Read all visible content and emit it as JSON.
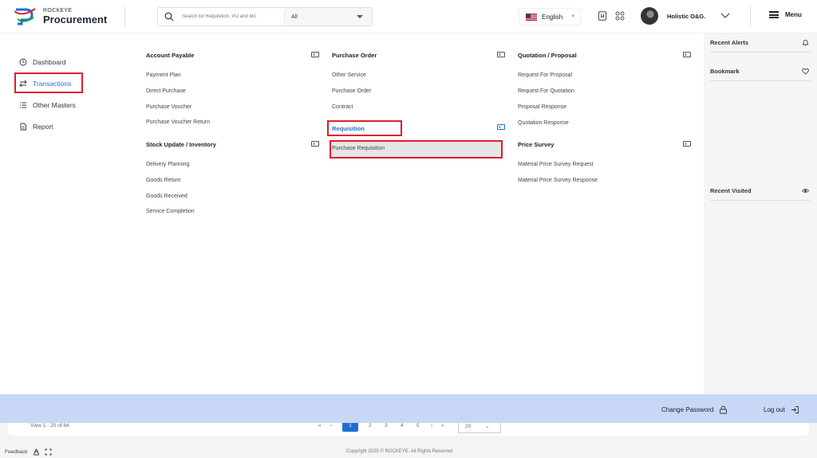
{
  "app": {
    "brand_top": "ROCKEYE",
    "brand_bottom": "Procurement"
  },
  "search": {
    "placeholder": "Search for Requisition, PO and Mo",
    "filter_value": "All"
  },
  "header": {
    "language": "English",
    "user_name": "Holistic O&G.",
    "menu_label": "Menu"
  },
  "sidebar": {
    "items": [
      {
        "label": "Dashboard",
        "icon": "clock-icon"
      },
      {
        "label": "Transactions",
        "icon": "swap-icon",
        "active": true
      },
      {
        "label": "Other Masters",
        "icon": "list-icon"
      },
      {
        "label": "Report",
        "icon": "document-icon"
      }
    ]
  },
  "mega_menu": {
    "account_payable": {
      "title": "Account Payable",
      "items": [
        "Payment Plan",
        "Direct Purchase",
        "Purchase Voucher",
        "Purchase Voucher Return"
      ]
    },
    "stock_update": {
      "title": "Stock Update / Inventory",
      "items": [
        "Delivery Planning",
        "Goods Return",
        "Goods Received",
        "Service Completion"
      ]
    },
    "purchase_order": {
      "title": "Purchase Order",
      "items": [
        "Other Service",
        "Purchase Order",
        "Contract"
      ]
    },
    "requisition": {
      "title": "Requisition",
      "items": [
        "Purchase Requisition"
      ]
    },
    "quotation": {
      "title": "Quotation / Proposal",
      "items": [
        "Request For Proposal",
        "Request For Quotation",
        "Proposal Response",
        "Quotation Response"
      ]
    },
    "price_survey": {
      "title": "Price Survey",
      "items": [
        "Material Price Survey Request",
        "Material Price Survey Response"
      ]
    }
  },
  "right_panel": {
    "recent_alerts": "Recent Alerts",
    "bookmark": "Bookmark",
    "recent_visited": "Recent Visited"
  },
  "footer": {
    "change_password": "Change Password",
    "logout": "Log out"
  },
  "pagination": {
    "view_text": "View 1 - 20 of 84",
    "pages": [
      "1",
      "2",
      "3",
      "4",
      "5"
    ],
    "page_size": "20"
  },
  "bottom": {
    "feedback": "Feedback",
    "copyright": "Copyright 2025 © ROCKEYE. All Rights Reserved"
  },
  "colors": {
    "accent": "#1f6fd1",
    "highlight_border": "#e11d2e",
    "footer_bar": "#c7d7f5"
  }
}
